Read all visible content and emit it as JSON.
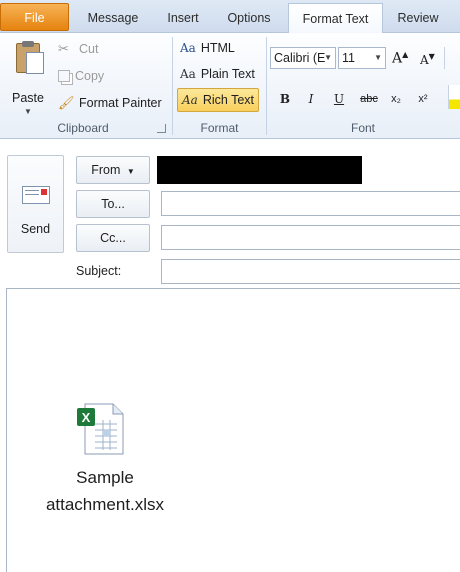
{
  "tabs": [
    {
      "label": "File"
    },
    {
      "label": "Message"
    },
    {
      "label": "Insert"
    },
    {
      "label": "Options"
    },
    {
      "label": "Format Text"
    },
    {
      "label": "Review"
    }
  ],
  "ribbon": {
    "clipboard": {
      "group_label": "Clipboard",
      "paste_label": "Paste",
      "cut_label": "Cut",
      "copy_label": "Copy",
      "format_painter_label": "Format Painter"
    },
    "format": {
      "group_label": "Format",
      "html_label": "HTML",
      "plain_text_label": "Plain Text",
      "rich_text_label": "Rich Text",
      "active": "Rich Text"
    },
    "font": {
      "group_label": "Font",
      "font_name": "Calibri (E",
      "font_size": "11",
      "bold": "B",
      "italic": "I",
      "underline": "U",
      "strikethrough": "abc",
      "subscript": "x₂",
      "superscript": "x²"
    }
  },
  "compose": {
    "send_label": "Send",
    "from_label": "From",
    "to_label": "To...",
    "cc_label": "Cc...",
    "subject_label": "Subject:",
    "to_value": "",
    "cc_value": "",
    "subject_value": ""
  },
  "body": {
    "attachment_name_line1": "Sample",
    "attachment_name_line2": "attachment.xlsx"
  },
  "colors": {
    "file_tab": "#e5830f",
    "accent_highlight": "#f8cf5c",
    "excel_green": "#1e7a3a"
  }
}
